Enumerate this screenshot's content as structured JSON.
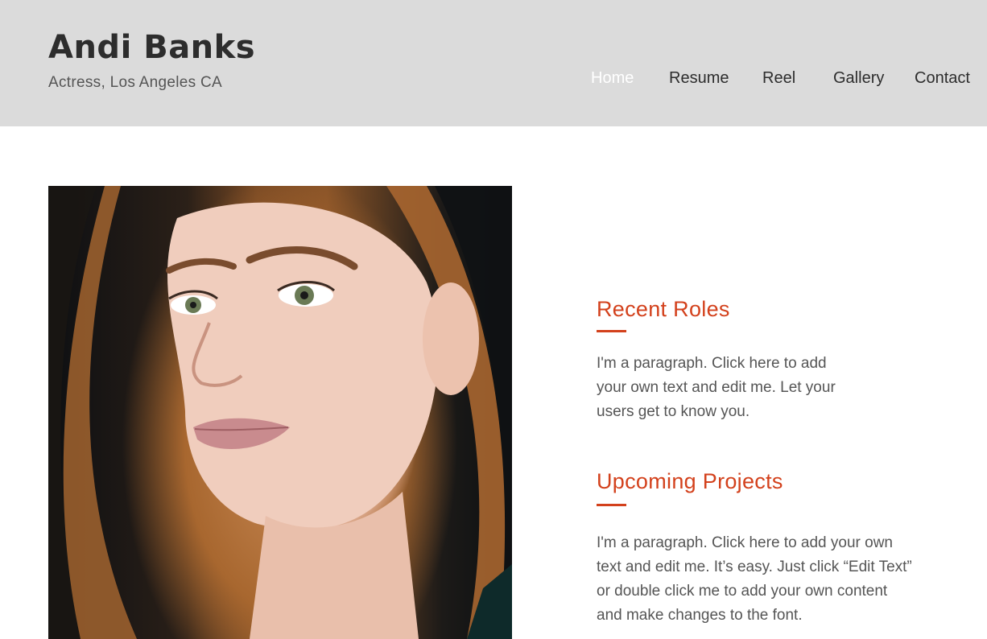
{
  "site": {
    "title": "Andi Banks",
    "tagline": "Actress, Los Angeles CA"
  },
  "nav": {
    "items": [
      {
        "label": "Home",
        "active": true
      },
      {
        "label": "Resume",
        "active": false
      },
      {
        "label": "Reel",
        "active": false
      },
      {
        "label": "Gallery",
        "active": false
      },
      {
        "label": "Contact",
        "active": false
      }
    ]
  },
  "main": {
    "sections": [
      {
        "heading": "Recent Roles",
        "paragraph_lines": [
          "I'm a paragraph. Click here to add",
          "your own text and edit me. Let your",
          "users get to know you."
        ]
      },
      {
        "heading": "Upcoming Projects",
        "paragraph_lines": [
          "I'm a paragraph. Click here to add your own",
          "text and edit me. It’s easy. Just click “Edit Text”",
          "or double click me to add your own content",
          "and make changes to the font."
        ]
      }
    ]
  },
  "colors": {
    "header_bg": "#dbdbdb",
    "accent": "#d3411c",
    "nav_active": "#ffffff",
    "text": "#2d2d2d"
  }
}
